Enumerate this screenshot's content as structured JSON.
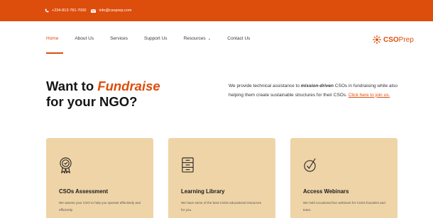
{
  "topbar": {
    "phone": "+234-813-781-7000",
    "email": "info@csoprep.com",
    "phone_icon": "phone-icon",
    "email_icon": "envelope-icon"
  },
  "nav": {
    "items": [
      {
        "label": "Home",
        "active": true
      },
      {
        "label": "About Us"
      },
      {
        "label": "Services"
      },
      {
        "label": "Support Us"
      },
      {
        "label": "Resources"
      },
      {
        "label": "Contact Us"
      }
    ],
    "resources_chevron": "⌄"
  },
  "logo": {
    "part1": "CSO",
    "part2": "Prep",
    "icon": "sunburst-logo-icon"
  },
  "hero": {
    "line1_prefix": "Want to ",
    "line1_emphasis": "Fundraise",
    "line2": "for your NGO?",
    "desc_prefix": "We provide technical assistance to ",
    "desc_emphasis": "mission-driven",
    "desc_middle": " CSOs in fundraising while also helping them create sustainable structures for their CSOs. ",
    "desc_link": "Click here to join us."
  },
  "cards": [
    {
      "title": "CSOs Assessment",
      "text": "We assess your CSO to help you operate effectively and efficiently.",
      "icon": "award-badge-icon"
    },
    {
      "title": "Learning Library",
      "text": "We have some of the best CSOs educational resources for you.",
      "icon": "cabinet-icon"
    },
    {
      "title": "Access Webinars",
      "text": "We hold occasional live webinars for CSOs founders and team.",
      "icon": "check-badge-icon"
    }
  ],
  "colors": {
    "accent": "#dd4d0c",
    "card_bg": "#efd4a8",
    "text": "#1c1c1c"
  }
}
